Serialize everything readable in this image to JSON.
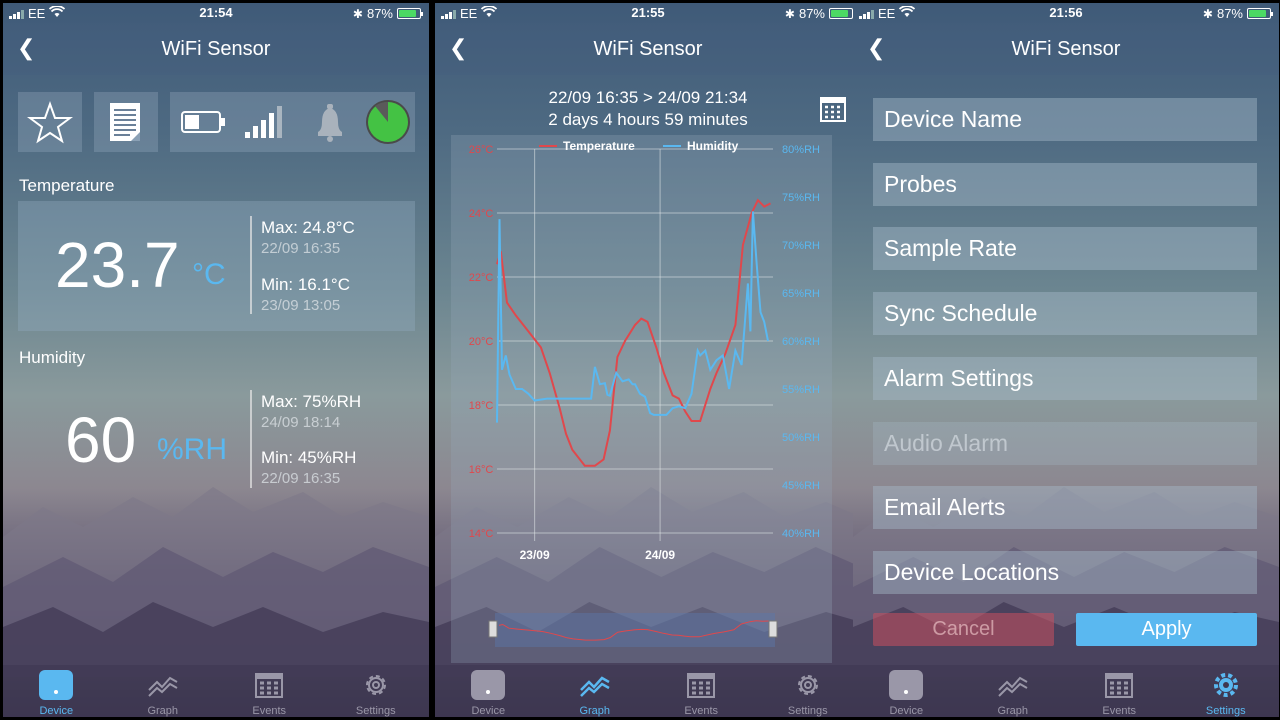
{
  "status": [
    {
      "carrier": "EE",
      "time": "21:54",
      "battery": "87%",
      "battery_level": 0.87
    },
    {
      "carrier": "EE",
      "time": "21:55",
      "battery": "87%",
      "battery_level": 0.87
    },
    {
      "carrier": "EE",
      "time": "21:56",
      "battery": "87%",
      "battery_level": 0.87
    }
  ],
  "nav_title": "WiFi Sensor",
  "device": {
    "status_icons": [
      "star-icon",
      "report-icon",
      "battery-icon",
      "signal-icon",
      "bell-icon",
      "status-circle-icon"
    ],
    "temperature": {
      "label": "Temperature",
      "value": "23.7",
      "unit": "°C",
      "max": "Max: 24.8°C",
      "max_time": "22/09 16:35",
      "min": "Min: 16.1°C",
      "min_time": "23/09 13:05"
    },
    "humidity": {
      "label": "Humidity",
      "value": "60",
      "unit": "%RH",
      "max": "Max: 75%RH",
      "max_time": "24/09 18:14",
      "min": "Min: 45%RH",
      "min_time": "22/09 16:35"
    }
  },
  "graph": {
    "range": "22/09 16:35 > 24/09 21:34",
    "duration": "2 days 4 hours 59 minutes"
  },
  "chart_data": {
    "type": "line",
    "title": "",
    "legend": [
      "Temperature",
      "Humidity"
    ],
    "legend_position": "top",
    "x_ticks": [
      "23/09",
      "24/09"
    ],
    "y_left_ticks": [
      "14°C",
      "16°C",
      "18°C",
      "20°C",
      "22°C",
      "24°C",
      "26°C"
    ],
    "y_left_range": [
      14,
      26
    ],
    "y_right_ticks": [
      "40%RH",
      "45%RH",
      "50%RH",
      "55%RH",
      "60%RH",
      "65%RH",
      "70%RH",
      "75%RH",
      "80%RH"
    ],
    "y_right_range": [
      40,
      80
    ],
    "x_range_days": [
      0,
      2.2
    ],
    "series": [
      {
        "name": "Temperature",
        "color": "#e0484c",
        "axis": "left",
        "x": [
          0.0,
          0.03,
          0.08,
          0.15,
          0.25,
          0.35,
          0.42,
          0.5,
          0.55,
          0.6,
          0.7,
          0.78,
          0.85,
          0.9,
          0.96,
          1.02,
          1.1,
          1.15,
          1.2,
          1.27,
          1.33,
          1.4,
          1.45,
          1.5,
          1.55,
          1.62,
          1.7,
          1.75,
          1.82,
          1.9,
          1.96,
          2.03,
          2.08,
          2.13,
          2.18
        ],
        "values": [
          22.4,
          22.8,
          21.2,
          20.8,
          20.3,
          19.8,
          19.0,
          17.9,
          17.1,
          16.6,
          16.1,
          16.1,
          16.3,
          17.2,
          19.5,
          20.0,
          20.5,
          20.7,
          20.6,
          19.8,
          19.0,
          18.3,
          18.2,
          17.8,
          17.5,
          17.5,
          18.5,
          19.0,
          19.6,
          20.5,
          23.0,
          24.0,
          24.4,
          24.2,
          24.3
        ]
      },
      {
        "name": "Humidity",
        "color": "#5ab8f0",
        "axis": "right",
        "x": [
          0.0,
          0.02,
          0.04,
          0.07,
          0.1,
          0.15,
          0.2,
          0.25,
          0.3,
          0.4,
          0.5,
          0.6,
          0.7,
          0.75,
          0.78,
          0.82,
          0.86,
          0.88,
          0.9,
          0.95,
          1.0,
          1.05,
          1.08,
          1.1,
          1.14,
          1.18,
          1.22,
          1.25,
          1.3,
          1.35,
          1.4,
          1.45,
          1.5,
          1.55,
          1.6,
          1.62,
          1.66,
          1.7,
          1.75,
          1.8,
          1.85,
          1.9,
          1.95,
          2.0,
          2.02,
          2.04,
          2.07,
          2.1,
          2.13,
          2.16
        ],
        "values": [
          51.5,
          72.7,
          57.0,
          58.5,
          56.5,
          55.0,
          55.0,
          54.5,
          53.8,
          54.0,
          54.0,
          54.0,
          54.0,
          54.0,
          57.3,
          55.5,
          55.6,
          54.4,
          54.3,
          56.7,
          55.8,
          56.0,
          55.5,
          55.5,
          54.5,
          54.2,
          52.5,
          52.3,
          52.3,
          52.3,
          53.0,
          53.2,
          53.0,
          54.5,
          59.0,
          58.5,
          59.0,
          57.0,
          58.0,
          58.5,
          55.0,
          59.0,
          57.5,
          66.0,
          61.0,
          73.5,
          68.0,
          63.0,
          62.0,
          60.0
        ]
      }
    ],
    "navigator": true
  },
  "settings": {
    "items": [
      {
        "label": "Device Name",
        "enabled": true
      },
      {
        "label": "Probes",
        "enabled": true
      },
      {
        "label": "Sample Rate",
        "enabled": true
      },
      {
        "label": "Sync Schedule",
        "enabled": true
      },
      {
        "label": "Alarm Settings",
        "enabled": true
      },
      {
        "label": "Audio Alarm",
        "enabled": false
      },
      {
        "label": "Email Alerts",
        "enabled": true
      },
      {
        "label": "Device Locations",
        "enabled": true
      }
    ],
    "cancel_label": "Cancel",
    "apply_label": "Apply"
  },
  "tabs": [
    {
      "label": "Device",
      "icon": "device-icon"
    },
    {
      "label": "Graph",
      "icon": "graph-icon"
    },
    {
      "label": "Events",
      "icon": "calendar-icon"
    },
    {
      "label": "Settings",
      "icon": "gear-icon"
    }
  ],
  "colors": {
    "accent": "#5ab8f0",
    "temperature": "#e0484c",
    "status_green": "#4cd964"
  }
}
